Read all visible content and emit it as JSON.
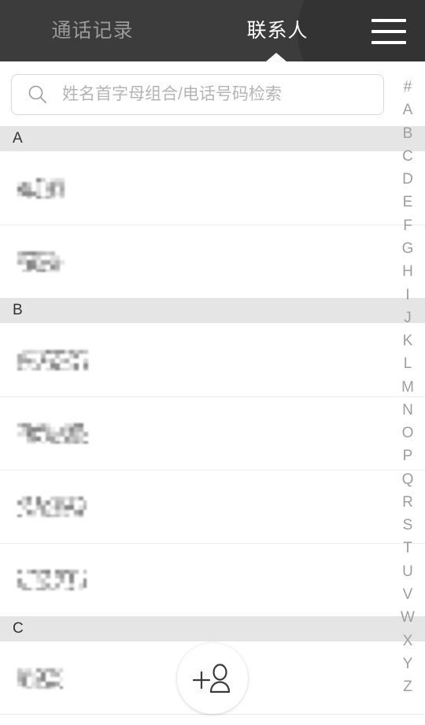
{
  "header": {
    "tabs": [
      {
        "label": "通话记录",
        "active": false,
        "name": "tab-call-log"
      },
      {
        "label": "联系人",
        "active": true,
        "name": "tab-contacts"
      }
    ],
    "menu_icon": "hamburger-menu-icon",
    "background_color": "#3c3c3c",
    "active_tab_color": "#ffffff",
    "inactive_tab_color": "#9a9a9a"
  },
  "search": {
    "placeholder": "姓名首字母组合/电话号码检索",
    "value": "",
    "icon": "search-icon",
    "border_color": "#d8d8d8"
  },
  "list": {
    "section_header_color": "#e5e5e5",
    "divider_color": "#ededed",
    "sections": [
      {
        "letter": "A",
        "contacts": [
          {
            "name": "",
            "redacted": true,
            "redaction_width": 62
          },
          {
            "name": "",
            "redacted": true,
            "redaction_width": 62
          }
        ]
      },
      {
        "letter": "B",
        "contacts": [
          {
            "name": "",
            "redacted": true,
            "redaction_width": 90
          },
          {
            "name": "",
            "redacted": true,
            "redaction_width": 90
          },
          {
            "name": "",
            "redacted": true,
            "redaction_width": 88
          },
          {
            "name": "",
            "redacted": true,
            "redaction_width": 88
          }
        ]
      },
      {
        "letter": "C",
        "contacts": [
          {
            "name": "",
            "redacted": true,
            "redaction_width": 58
          }
        ]
      }
    ]
  },
  "index_rail": {
    "letters": [
      "#",
      "A",
      "B",
      "C",
      "D",
      "E",
      "F",
      "G",
      "H",
      "I",
      "J",
      "K",
      "L",
      "M",
      "N",
      "O",
      "P",
      "Q",
      "R",
      "S",
      "T",
      "U",
      "V",
      "W",
      "X",
      "Y",
      "Z"
    ],
    "color": "#9e9e9e"
  },
  "fab": {
    "icon": "add-contact-icon",
    "label": "",
    "background_color": "#ffffff",
    "icon_color": "#3a3a3a"
  }
}
